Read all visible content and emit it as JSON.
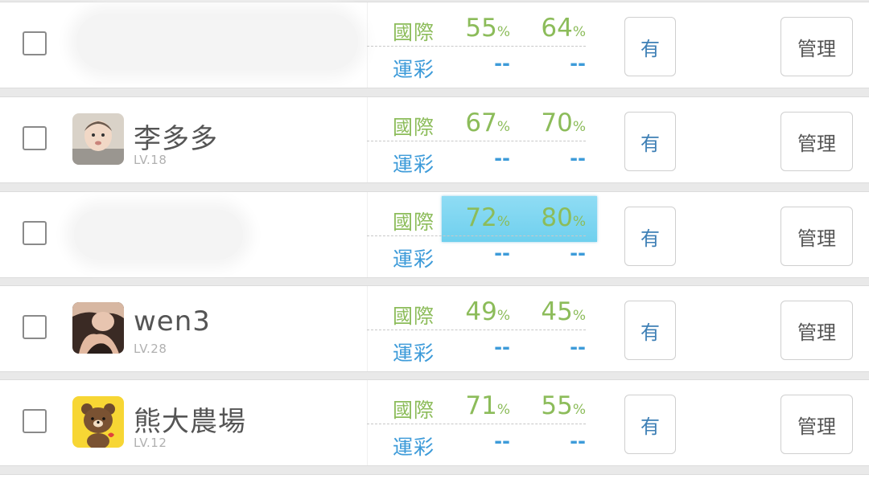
{
  "labels": {
    "international": "國際",
    "lottery": "運彩",
    "percent_unit": "%",
    "empty_value": "--",
    "have_button": "有",
    "manage_button": "管理"
  },
  "rows": [
    {
      "name": "",
      "level": "",
      "intl_rate_1": "55",
      "intl_rate_2": "64",
      "lottery_rate_1": "--",
      "lottery_rate_2": "--",
      "avatar": "blurred",
      "highlighted": false
    },
    {
      "name": "李多多",
      "level": "LV.18",
      "intl_rate_1": "67",
      "intl_rate_2": "70",
      "lottery_rate_1": "--",
      "lottery_rate_2": "--",
      "avatar": "baby-photo",
      "highlighted": false
    },
    {
      "name": "",
      "level": "",
      "intl_rate_1": "72",
      "intl_rate_2": "80",
      "lottery_rate_1": "--",
      "lottery_rate_2": "--",
      "avatar": "blurred",
      "highlighted": true
    },
    {
      "name": "wen3",
      "level": "LV.28",
      "intl_rate_1": "49",
      "intl_rate_2": "45",
      "lottery_rate_1": "--",
      "lottery_rate_2": "--",
      "avatar": "person-photo",
      "highlighted": false
    },
    {
      "name": "熊大農場",
      "level": "LV.12",
      "intl_rate_1": "71",
      "intl_rate_2": "55",
      "lottery_rate_1": "--",
      "lottery_rate_2": "--",
      "avatar": "brown-bear-sticker",
      "highlighted": false
    }
  ],
  "colors": {
    "international_green": "#8cbc5a",
    "lottery_blue": "#3d9bd9",
    "highlight_cyan": "#7fd6f1"
  }
}
